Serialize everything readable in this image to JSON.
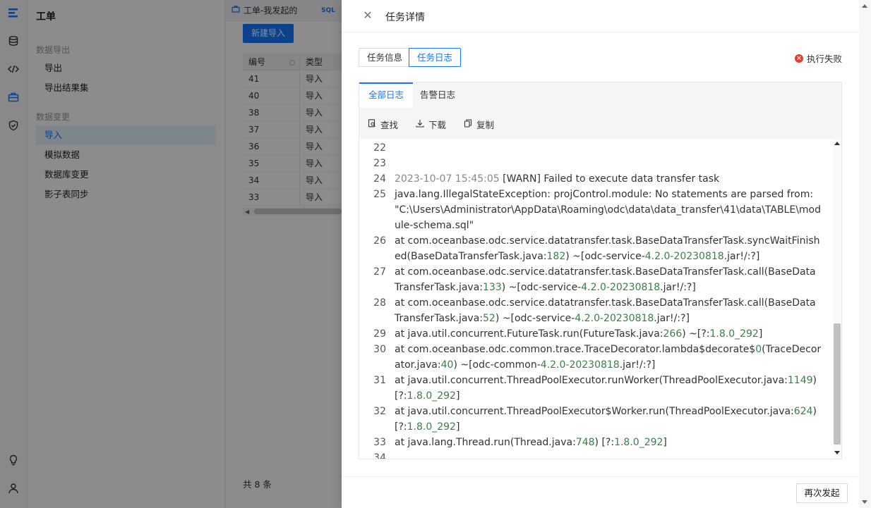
{
  "sidebar": {
    "title": "工单",
    "groups": [
      {
        "label": "数据导出",
        "items": [
          "导出",
          "导出结果集"
        ]
      },
      {
        "label": "数据变更",
        "items": [
          "导入",
          "模拟数据",
          "数据库变更",
          "影子表同步"
        ]
      }
    ],
    "active_item": "导入"
  },
  "rail_icons": [
    "logo-icon",
    "database-icon",
    "code-icon",
    "briefcase-icon",
    "shield-icon",
    "lightbulb-icon",
    "user-icon"
  ],
  "main": {
    "tabs": [
      {
        "label": "工单-我发起的",
        "icon": "briefcase-icon"
      },
      {
        "label": "SQL",
        "icon": "sql-icon"
      }
    ],
    "new_import_button": "新建导入",
    "table": {
      "headers": [
        "编号",
        "类型"
      ],
      "rows": [
        [
          "41",
          "导入"
        ],
        [
          "40",
          "导入"
        ],
        [
          "38",
          "导入"
        ],
        [
          "37",
          "导入"
        ],
        [
          "36",
          "导入"
        ],
        [
          "35",
          "导入"
        ],
        [
          "34",
          "导入"
        ],
        [
          "33",
          "导入"
        ]
      ]
    },
    "total": "共 8 条"
  },
  "drawer": {
    "title": "任务详情",
    "tabs": [
      "任务信息",
      "任务日志"
    ],
    "active_tab": "任务日志",
    "status": "执行失败",
    "log_tabs": [
      "全部日志",
      "告警日志"
    ],
    "active_log_tab": "全部日志",
    "toolbar": {
      "find": "查找",
      "download": "下载",
      "copy": "复制"
    },
    "retry_button": "再次发起",
    "log_lines": [
      {
        "n": "22",
        "t": ""
      },
      {
        "n": "23",
        "t": ""
      },
      {
        "n": "24",
        "t": "2023-10-07 15:45:05 [WARN] Failed to execute data transfer task"
      },
      {
        "n": "25",
        "t": "java.lang.IllegalStateException: projControl.module: No statements are parsed from: \"C:\\Users\\Administrator\\AppData\\Roaming\\odc\\data\\data_transfer\\41\\data\\TABLE\\module-schema.sql\""
      },
      {
        "n": "26",
        "t": "at com.oceanbase.odc.service.datatransfer.task.BaseDataTransferTask.syncWaitFinished(BaseDataTransferTask.java:182) ~[odc-service-4.2.0-20230818.jar!/:?]"
      },
      {
        "n": "27",
        "t": "at com.oceanbase.odc.service.datatransfer.task.BaseDataTransferTask.call(BaseDataTransferTask.java:133) ~[odc-service-4.2.0-20230818.jar!/:?]"
      },
      {
        "n": "28",
        "t": "at com.oceanbase.odc.service.datatransfer.task.BaseDataTransferTask.call(BaseDataTransferTask.java:52) ~[odc-service-4.2.0-20230818.jar!/:?]"
      },
      {
        "n": "29",
        "t": "at java.util.concurrent.FutureTask.run(FutureTask.java:266) ~[?:1.8.0_292]"
      },
      {
        "n": "30",
        "t": "at com.oceanbase.odc.common.trace.TraceDecorator.lambda$decorate$0(TraceDecorator.java:40) ~[odc-common-4.2.0-20230818.jar!/:?]"
      },
      {
        "n": "31",
        "t": "at java.util.concurrent.ThreadPoolExecutor.runWorker(ThreadPoolExecutor.java:1149) [?:1.8.0_292]"
      },
      {
        "n": "32",
        "t": "at java.util.concurrent.ThreadPoolExecutor$Worker.run(ThreadPoolExecutor.java:624) [?:1.8.0_292]"
      },
      {
        "n": "33",
        "t": "at java.lang.Thread.run(Thread.java:748) [?:1.8.0_292]"
      },
      {
        "n": "34",
        "t": ""
      }
    ]
  },
  "colors": {
    "accent": "#1677ff",
    "error": "#e8392f",
    "log_number": "#3a7d4a"
  }
}
